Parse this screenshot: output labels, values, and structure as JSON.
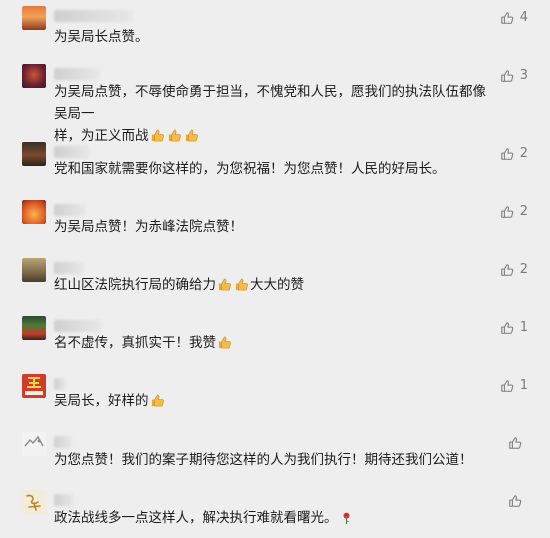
{
  "comments": [
    {
      "likes": "4",
      "text": "为吴局长点赞。",
      "emoji_count": 0,
      "trail": ""
    },
    {
      "likes": "3",
      "text_line1": "为吴局点赞，不辱使命勇于担当，不愧党和人民，愿我们的执法队伍都像吴局一",
      "text_line2": "样，为正义而战",
      "emoji_count": 3
    },
    {
      "likes": "2",
      "text": "党和国家就需要你这样的，为您祝福！为您点赞！人民的好局长。"
    },
    {
      "likes": "2",
      "text": "为吴局点赞！为赤峰法院点赞！"
    },
    {
      "likes": "2",
      "text_before": "红山区法院执行局的确给力",
      "text_after": "大大的赞"
    },
    {
      "likes": "1",
      "text": "名不虚传，真抓实干！我赞"
    },
    {
      "likes": "1",
      "text": "吴局长，好样的"
    },
    {
      "likes": "",
      "text": "为您点赞！我们的案子期待您这样的人为我们执行！期待还我们公道！"
    },
    {
      "likes": "",
      "text": "政法战线多一点这样人，解决执行难就看曙光。"
    }
  ],
  "icons": {
    "like": "thumbs-up-outline-icon",
    "emoji_thumb": "thumbs-up-emoji-icon",
    "emoji_rose": "rose-emoji-icon"
  },
  "colors": {
    "background": "#eeeeee",
    "text": "#1c1c1c",
    "like": "#7a7a7a",
    "emoji": "#f2b33d"
  }
}
